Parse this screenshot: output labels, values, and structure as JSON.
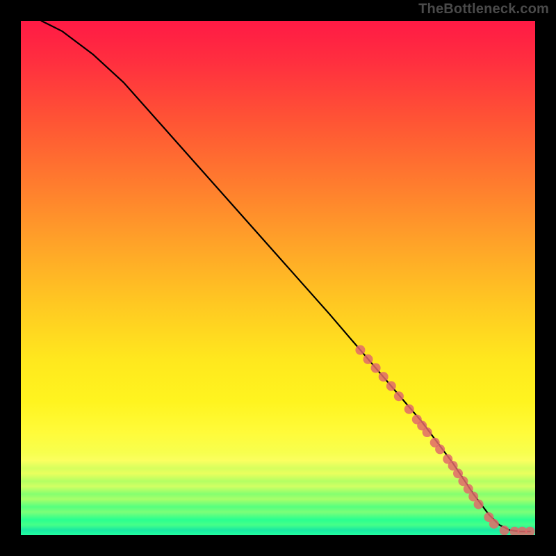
{
  "watermark": "TheBottleneck.com",
  "chart_data": {
    "type": "line",
    "title": "",
    "xlabel": "",
    "ylabel": "",
    "xlim": [
      0,
      100
    ],
    "ylim": [
      0,
      100
    ],
    "grid": false,
    "legend": false,
    "series": [
      {
        "name": "curve",
        "style": "line",
        "color": "#000000",
        "x": [
          4,
          6,
          8,
          10,
          14,
          20,
          28,
          36,
          44,
          52,
          60,
          66,
          72,
          78,
          84,
          88,
          91,
          93,
          95,
          97,
          99
        ],
        "y": [
          100,
          99,
          98,
          96.5,
          93.5,
          88,
          79,
          70,
          61,
          52,
          43,
          36,
          29,
          22,
          14,
          8,
          4,
          2,
          1,
          0.7,
          0.7
        ]
      },
      {
        "name": "markers",
        "style": "scatter",
        "color": "#e06a6a",
        "x": [
          66,
          67.5,
          69,
          70.5,
          72,
          73.5,
          75.5,
          77,
          78,
          79,
          80.5,
          81.5,
          83,
          84,
          85,
          86,
          87,
          88,
          89,
          91,
          92,
          94,
          96,
          97.5,
          99
        ],
        "y": [
          36,
          34.2,
          32.5,
          30.8,
          29,
          27,
          24.5,
          22.5,
          21.3,
          20,
          18,
          16.7,
          14.8,
          13.5,
          12,
          10.5,
          9,
          7.5,
          6,
          3.5,
          2.2,
          0.9,
          0.7,
          0.7,
          0.7
        ]
      }
    ]
  },
  "colors": {
    "marker": "#e06a6a",
    "line": "#000000",
    "frame_bg": "#000000"
  }
}
